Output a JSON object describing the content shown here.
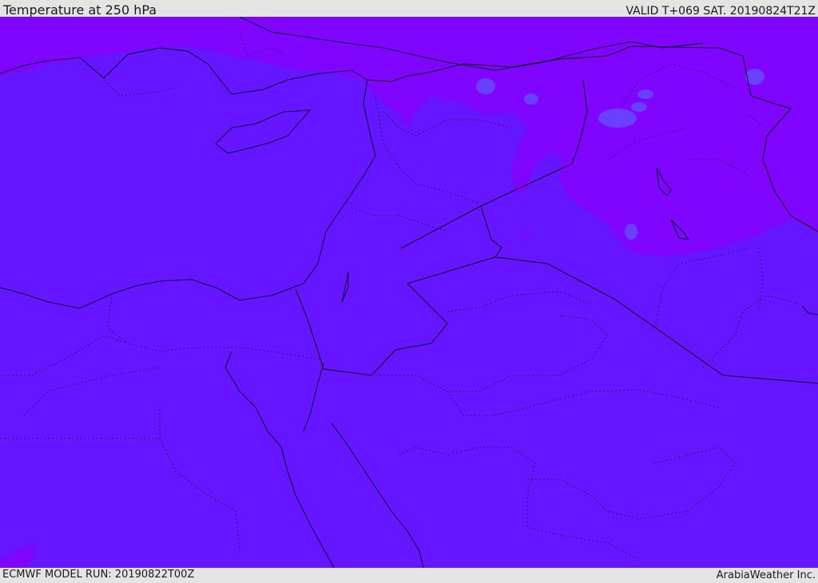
{
  "header": {
    "title": "Temperature at 250 hPa",
    "valid": "VALID T+069 SAT. 20190824T21Z"
  },
  "footer": {
    "model_run": "ECMWF MODEL RUN: 20190822T00Z",
    "credit": "ArabiaWeather Inc."
  },
  "map": {
    "colors": {
      "field_main": "#6515ff",
      "field_cold": "#7f05ff",
      "field_coldest": "#6a40ff",
      "international_border": "#111111",
      "internal_border": "#2a1a66",
      "coastline": "#0d0d33"
    }
  }
}
